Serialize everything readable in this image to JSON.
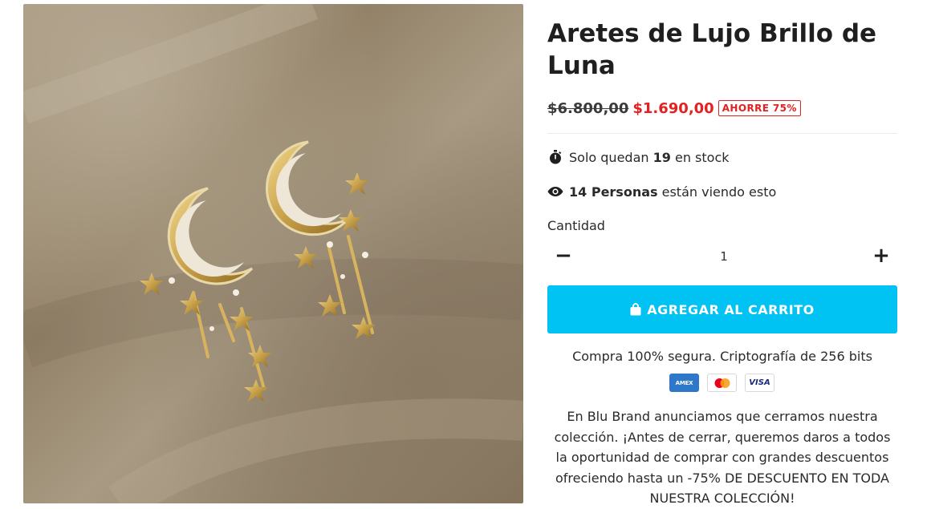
{
  "product": {
    "title": "Aretes de Lujo Brillo de Luna",
    "image_alt": "Aretes dorados en forma de luna con estrellas colgantes",
    "old_price": "$6.800,00",
    "new_price": "$1.690,00",
    "save_badge": "AHORRE 75%",
    "stock": {
      "prefix": "Solo quedan",
      "count": "19",
      "suffix": "en stock",
      "icon": "stopwatch-icon"
    },
    "viewers": {
      "count_label": "14 Personas",
      "suffix": "están viendo esto",
      "icon": "eye-icon"
    },
    "quantity": {
      "label": "Cantidad",
      "value": "1",
      "decrement": "−",
      "increment": "+"
    },
    "add_to_cart": {
      "label": "AGREGAR AL CARRITO",
      "icon": "shopping-bag-icon"
    },
    "secure_text": "Compra 100% segura. Criptografía de 256 bits",
    "payment_cards": [
      {
        "name": "amex",
        "label": "AMEX"
      },
      {
        "name": "mastercard",
        "label": ""
      },
      {
        "name": "visa",
        "label": "VISA"
      }
    ],
    "description": "En Blu Brand anunciamos que cerramos nuestra colección. ¡Antes de cerrar, queremos daros a todos la oportunidad de comprar con grandes descuentos ofreciendo hasta un -75% DE DESCUENTO EN TODA NUESTRA COLECCIÓN!"
  },
  "colors": {
    "accent": "#00c2f3",
    "sale_red": "#e22120",
    "text": "#1f1f1f",
    "gold": "#c9a24a"
  }
}
